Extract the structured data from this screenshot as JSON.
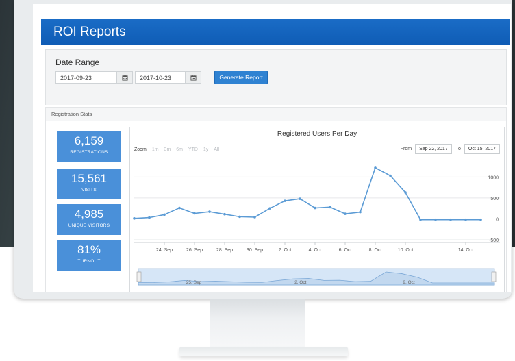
{
  "header": {
    "title": "ROI Reports"
  },
  "date_range": {
    "label": "Date Range",
    "start_value": "2017-09-23",
    "end_value": "2017-10-23",
    "calendar_icon": "calendar-icon",
    "generate_label": "Generate Report"
  },
  "stats": {
    "title": "Registration Stats",
    "boxes": [
      {
        "value": "6,159",
        "label": "REGISTRATIONS"
      },
      {
        "value": "15,561",
        "label": "VISITS"
      },
      {
        "value": "4,985",
        "label": "UNIQUE VISITORS"
      },
      {
        "value": "81%",
        "label": "TURNOUT"
      }
    ]
  },
  "chart": {
    "zoom_label": "Zoom",
    "zoom_buttons": [
      "1m",
      "3m",
      "6m",
      "YTD",
      "1y",
      "All"
    ],
    "from_label": "From",
    "from_value": "Sep 22, 2017",
    "to_label": "To",
    "to_value": "Oct 15, 2017",
    "navigator_labels": [
      "25. Sep",
      "2. Oct",
      "9. Oct"
    ]
  },
  "colors": {
    "header": "#1565c0",
    "stat_box": "#4a90d9",
    "button": "#2f82d2",
    "series": "#5b9bd5",
    "navigator_fill": "#d6e6f7"
  },
  "chart_data": {
    "type": "line",
    "title": "Registered Users Per Day",
    "x": [
      "2017-09-22",
      "2017-09-23",
      "2017-09-24",
      "2017-09-25",
      "2017-09-26",
      "2017-09-27",
      "2017-09-28",
      "2017-09-29",
      "2017-09-30",
      "2017-10-01",
      "2017-10-02",
      "2017-10-03",
      "2017-10-04",
      "2017-10-05",
      "2017-10-06",
      "2017-10-07",
      "2017-10-08",
      "2017-10-09",
      "2017-10-10",
      "2017-10-11",
      "2017-10-12",
      "2017-10-13",
      "2017-10-14",
      "2017-10-15"
    ],
    "series": [
      {
        "values": [
          10,
          30,
          100,
          260,
          130,
          170,
          110,
          50,
          40,
          250,
          430,
          480,
          260,
          280,
          120,
          160,
          1220,
          1030,
          630,
          -20,
          -20,
          -20,
          -20,
          -20
        ]
      }
    ],
    "x_tick_labels": [
      "24. Sep",
      "26. Sep",
      "28. Sep",
      "30. Sep",
      "2. Oct",
      "4. Oct",
      "6. Oct",
      "8. Oct",
      "10. Oct",
      "14. Oct"
    ],
    "y_tick_labels": [
      "1000",
      "500",
      "0",
      "-500"
    ],
    "ylim": [
      -500,
      1300
    ],
    "grid": true,
    "legend": "none"
  }
}
